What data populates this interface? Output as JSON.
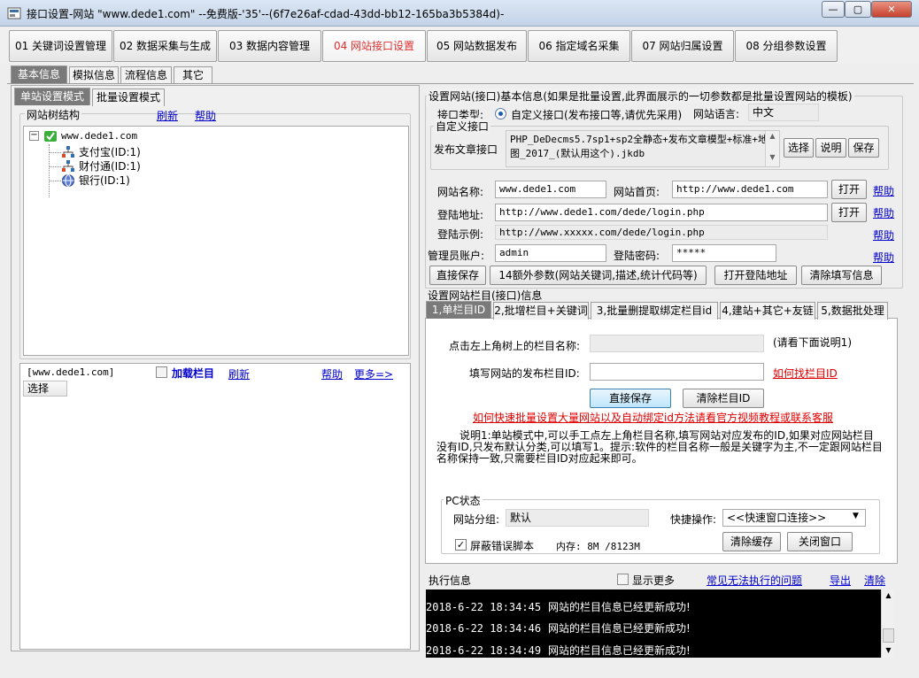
{
  "window": {
    "title": "接口设置-网站 \"www.dede1.com\" --免费版-'35'--(6f7e26af-cdad-43dd-bb12-165ba3b5384d)-",
    "min_glyph": "—",
    "max_glyph": "▢",
    "close_glyph": "✕"
  },
  "main_tabs": [
    {
      "label": "01 关键词设置管理"
    },
    {
      "label": "02 数据采集与生成"
    },
    {
      "label": "03 数据内容管理"
    },
    {
      "label": "04 网站接口设置"
    },
    {
      "label": "05 网站数据发布"
    },
    {
      "label": "06 指定域名采集"
    },
    {
      "label": "07 网站归属设置"
    },
    {
      "label": "08 分组参数设置"
    }
  ],
  "sub_tabs": [
    {
      "label": "基本信息"
    },
    {
      "label": "模拟信息"
    },
    {
      "label": "流程信息"
    },
    {
      "label": "其它"
    }
  ],
  "left": {
    "mode_tabs": [
      {
        "label": "单站设置模式"
      },
      {
        "label": "批量设置模式"
      }
    ],
    "tree_group_label": "网站树结构",
    "refresh": "刷新",
    "help": "帮助",
    "tree_root": "www.dede1.com",
    "tree_children": [
      {
        "label": "支付宝(ID:1)"
      },
      {
        "label": "财付通(ID:1)"
      },
      {
        "label": "银行(ID:1)"
      }
    ],
    "expander": "−",
    "bottom": {
      "site": "[www.dede1.com]",
      "load_columns": "加载栏目",
      "refresh": "刷新",
      "help": "帮助",
      "more": "更多=>",
      "select_header": "选择"
    }
  },
  "right": {
    "basic_group_label": "设置网站(接口)基本信息(如果是批量设置,此界面展示的一切参数都是批量设置网站的模板)",
    "iface_type_label": "接口类型:",
    "iface_type_option": "自定义接口(发布接口等,请优先采用)",
    "lang_label": "网站语言:",
    "lang_value": "中文",
    "custom_group_label": "自定义接口",
    "publish_iface_label": "发布文章接口",
    "publish_iface_value": "PHP_DeDecms5.7sp1+sp2全静态+发布文章模型+标准+地图_2017_(默认用这个).jkdb",
    "btn_choose": "选择",
    "btn_explain": "说明",
    "btn_save": "保存",
    "site_name_label": "网站名称:",
    "site_name_value": "www.dede1.com",
    "homepage_label": "网站首页:",
    "homepage_value": "http://www.dede1.com",
    "open": "打开",
    "help": "帮助",
    "login_url_label": "登陆地址:",
    "login_url_value": "http://www.dede1.com/dede/login.php",
    "login_example_label": "登陆示例:",
    "login_example_value": "http://www.xxxxx.com/dede/login.php",
    "admin_label": "管理员账户:",
    "admin_value": "admin",
    "password_label": "登陆密码:",
    "password_value": "*****",
    "btn_direct_save": "直接保存",
    "btn_extra": "14额外参数(网站关键词,描述,统计代码等)",
    "btn_open_login": "打开登陆地址",
    "btn_clear": "清除填写信息",
    "column_group_label": "设置网站栏目(接口)信息",
    "column_tabs": [
      {
        "label": "1,单栏目ID"
      },
      {
        "label": "2,批增栏目+关键词"
      },
      {
        "label": "3,批量删提取绑定栏目id"
      },
      {
        "label": "4,建站+其它+友链"
      },
      {
        "label": "5,数据批处理"
      }
    ],
    "col_name_label": "点击左上角树上的栏目名称:",
    "col_name_hint": "(请看下面说明1)",
    "col_id_label": "填写网站的发布栏目ID:",
    "col_id_link": "如何找栏目ID",
    "btn_col_save": "直接保存",
    "btn_col_clear": "清除栏目ID",
    "batch_tip": "如何快速批量设置大量网站以及自动绑定id方法请看官方视频教程或联系客服",
    "note": "说明1:单站模式中,可以手工点左上角栏目名称,填写网站对应发布的ID,如果对应网站栏目没有ID,只发布默认分类,可以填写1。提示:软件的栏目名称一般是关键字为主,不一定跟网站栏目名称保持一致,只需要栏目ID对应起来即可。",
    "pc_group_label": "PC状态",
    "site_group_label": "网站分组:",
    "site_group_value": "默认",
    "quick_label": "快捷操作:",
    "quick_value": "<<快速窗口连接>>",
    "mask_errors": "屏蔽错误脚本",
    "memory": "内存: 8M /8123M",
    "btn_clear_cache": "清除缓存",
    "btn_close_window": "关闭窗口"
  },
  "exec": {
    "label": "执行信息",
    "show_more": "显示更多",
    "faq": "常见无法执行的问题",
    "export": "导出",
    "clear": "清除",
    "logs": [
      {
        "time": "2018-6-22 18:34:45",
        "msg": "网站的栏目信息已经更新成功!"
      },
      {
        "time": "2018-6-22 18:34:46",
        "msg": "网站的栏目信息已经更新成功!"
      },
      {
        "time": "2018-6-22 18:34:49",
        "msg": "网站的栏目信息已经更新成功!"
      }
    ]
  },
  "colors": {
    "active_tab": "#e03030",
    "link": "#0000cc",
    "red_link": "#e00000"
  }
}
